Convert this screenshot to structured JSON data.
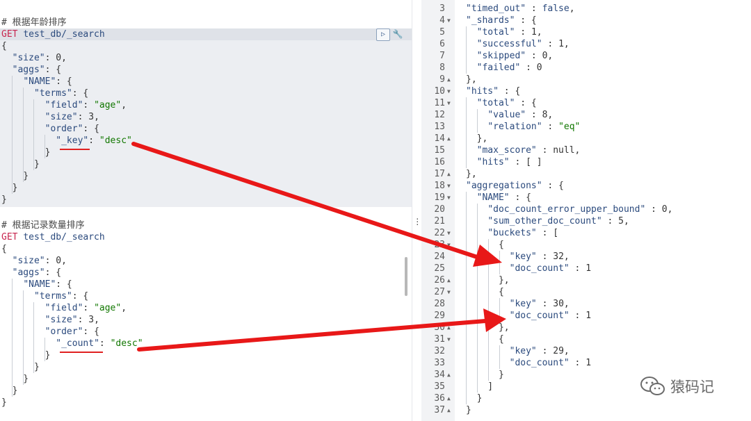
{
  "left": {
    "block1": {
      "comment": "# 根据年龄排序",
      "method": "GET",
      "url": "test_db/_search",
      "lines": [
        "{",
        "\"size\"",
        "0",
        "\"aggs\"",
        "\"NAME\"",
        "\"terms\"",
        "\"field\"",
        "\"age\"",
        "\"size\"",
        "3",
        "\"order\"",
        "\"_key\"",
        "\"desc\""
      ]
    },
    "block2": {
      "comment": "# 根据记录数量排序",
      "method": "GET",
      "url": "test_db/_search",
      "order_key": "\"_count\"",
      "order_val": "\"desc\""
    },
    "toolbar": {
      "run_icon": "play-icon",
      "settings_icon": "wrench-icon"
    }
  },
  "right": {
    "line_numbers": [
      "3",
      "4",
      "5",
      "6",
      "7",
      "8",
      "9",
      "10",
      "11",
      "12",
      "13",
      "14",
      "15",
      "16",
      "17",
      "18",
      "19",
      "20",
      "21",
      "22",
      "23",
      "24",
      "25",
      "26",
      "27",
      "28",
      "29",
      "30",
      "31",
      "32",
      "33",
      "34",
      "35",
      "36",
      "37"
    ],
    "timed_out": "false",
    "shards": {
      "total": "1",
      "successful": "1",
      "skipped": "0",
      "failed": "0"
    },
    "hits": {
      "value": "8",
      "relation": "\"eq\"",
      "max_score": "null"
    },
    "aggs": {
      "doc_count_error_upper_bound": "0",
      "sum_other_doc_count": "5"
    },
    "buckets": [
      {
        "key": "32",
        "doc_count": "1"
      },
      {
        "key": "30",
        "doc_count": "1"
      },
      {
        "key": "29",
        "doc_count": "1"
      }
    ]
  },
  "watermark": {
    "text": "猿码记",
    "icon": "wechat-icon"
  },
  "colors": {
    "arrow": "#e81818",
    "string": "#117700",
    "key": "#2b4a7d",
    "method": "#c7254e"
  }
}
